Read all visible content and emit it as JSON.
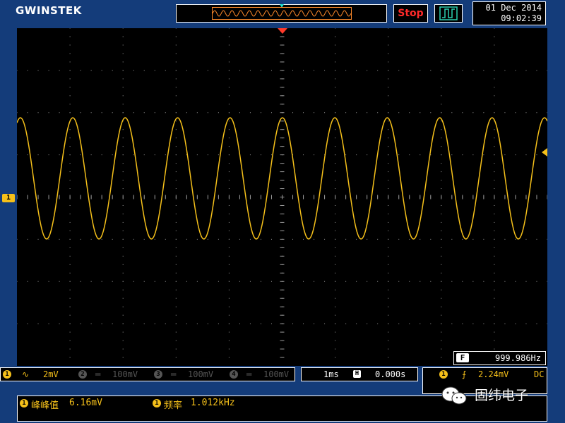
{
  "header": {
    "brand": "GWINSTEK",
    "run_state": "Stop",
    "date": "01 Dec 2014",
    "time": "09:02:39"
  },
  "waveform": {
    "channel": "1",
    "color": "#f5c01a",
    "grid_color": "#9a9a9a",
    "trigger_position_color": "#ff3a2a",
    "cycles_on_screen": 10.12
  },
  "frequency_counter": {
    "label": "F",
    "value": "999.986Hz"
  },
  "channels": [
    {
      "num": "1",
      "coupling_symbol": "∿",
      "scale": "2mV"
    },
    {
      "num": "2",
      "coupling_symbol": "═",
      "scale": "100mV"
    },
    {
      "num": "3",
      "coupling_symbol": "═",
      "scale": "100mV"
    },
    {
      "num": "4",
      "coupling_symbol": "═",
      "scale": "100mV"
    }
  ],
  "timebase": {
    "scale": "1ms",
    "h_icon": "H",
    "position": "0.000s"
  },
  "trigger": {
    "source": "1",
    "slope_symbol": "⨍",
    "level": "2.24mV",
    "coupling": "DC"
  },
  "measurements": [
    {
      "source": "1",
      "label": "峰峰值",
      "value": "6.16mV"
    },
    {
      "source": "1",
      "label": "频率",
      "value": "1.012kHz"
    }
  ],
  "watermark": {
    "text": "固纬电子",
    "icon": "wechat-icon"
  }
}
